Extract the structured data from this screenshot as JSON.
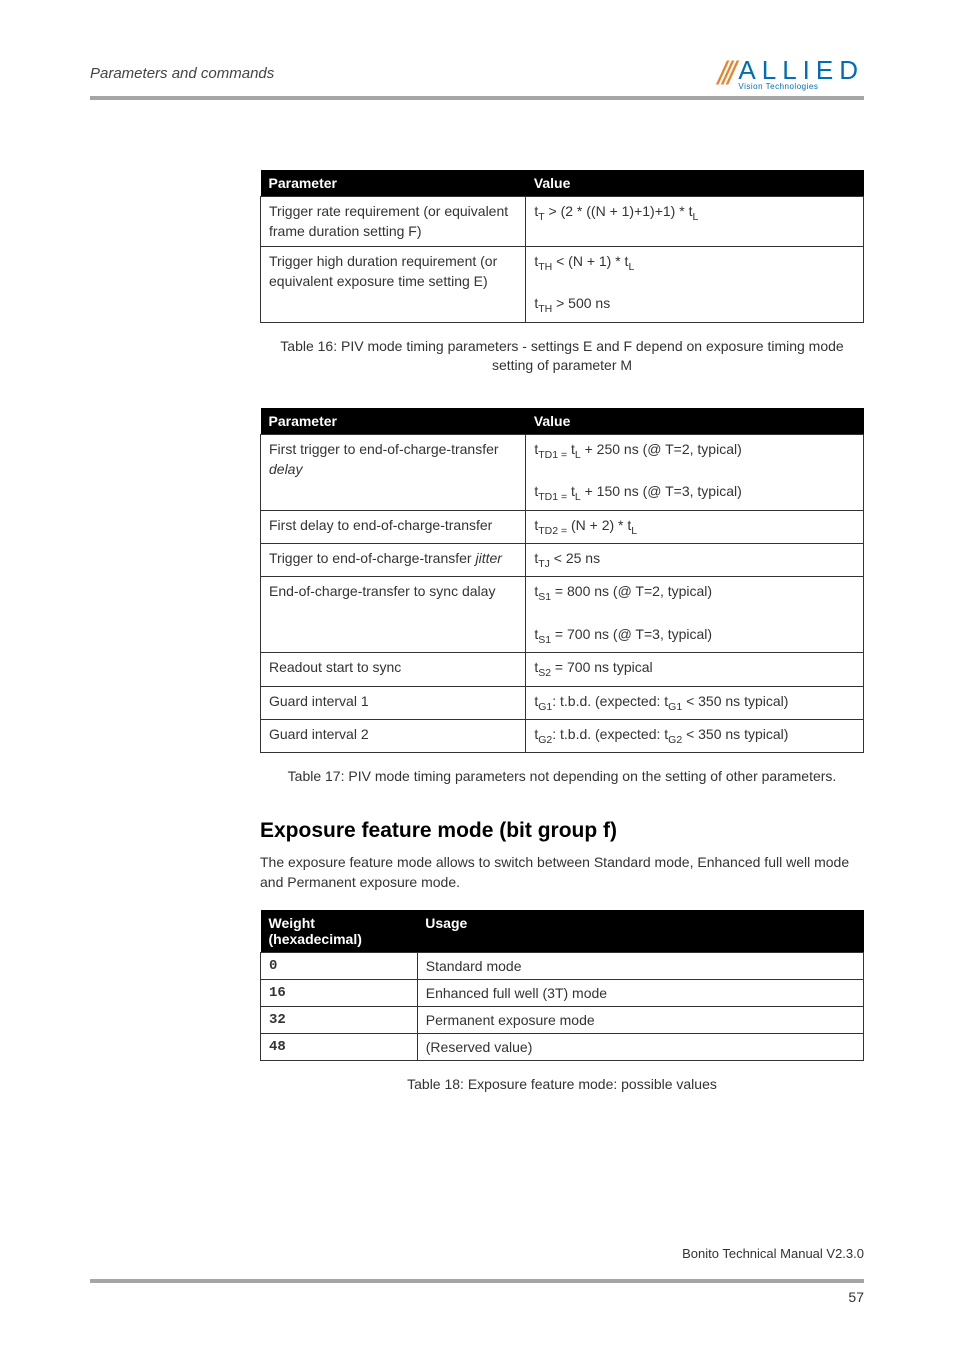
{
  "header": {
    "section": "Parameters and commands",
    "logo_main": "ALLIED",
    "logo_sub": "Vision Technologies"
  },
  "table16": {
    "col1": "Parameter",
    "col2": "Value",
    "rows": [
      {
        "p": "Trigger rate requirement (or equivalent frame duration setting F)",
        "v": "t<sub>T</sub> > (2 * ((N + 1)+1)+1) * t<sub>L</sub>"
      },
      {
        "p": "Trigger high duration requirement (or equivalent exposure time setting E)",
        "v": "t<sub>TH</sub> < (N + 1) * t<sub>L</sub><br><br>t<sub>TH</sub> > 500 ns"
      }
    ],
    "caption": "Table 16: PIV mode timing parameters - settings E and F depend on exposure timing mode setting of parameter M"
  },
  "table17": {
    "col1": "Parameter",
    "col2": "Value",
    "rows": [
      {
        "p": "First trigger to end-of-charge-transfer <span class=\"ital\">delay</span>",
        "v": "t<sub>TD1 =</sub> t<sub>L</sub> + 250 ns (@ T=2, typical)<br><br>t<sub>TD1 =</sub> t<sub>L</sub> + 150 ns (@ T=3, typical)"
      },
      {
        "p": "First delay to end-of-charge-transfer",
        "v": "t<sub>TD2 =</sub> (N + 2) * t<sub>L</sub>"
      },
      {
        "p": "Trigger to end-of-charge-transfer <span class=\"ital\">jitter</span>",
        "v": "t<sub>TJ</sub> < 25 ns"
      },
      {
        "p": "End-of-charge-transfer to sync dalay",
        "v": "t<sub>S1</sub> = 800 ns (@ T=2, typical)<br><br>t<sub>S1</sub> = 700 ns (@ T=3, typical)"
      },
      {
        "p": "Readout start to sync",
        "v": "t<sub>S2</sub> = 700 ns typical"
      },
      {
        "p": "Guard interval 1",
        "v": "t<sub>G1</sub>: t.b.d. (expected: t<sub>G1</sub> < 350 ns typical)"
      },
      {
        "p": "Guard interval 2",
        "v": "t<sub>G2</sub>: t.b.d. (expected: t<sub>G2</sub> < 350 ns typical)"
      }
    ],
    "caption": "Table 17: PIV mode timing parameters not depending on the setting of other parameters."
  },
  "section": {
    "heading": "Exposure feature mode (bit group f)",
    "text": "The exposure feature mode allows to switch between Standard mode, Enhanced full well mode and Permanent exposure mode."
  },
  "table18": {
    "col1": "Weight (hexadecimal)",
    "col2": "Usage",
    "rows": [
      {
        "w": "0",
        "u": "Standard mode"
      },
      {
        "w": "16",
        "u": "Enhanced full well (3T) mode"
      },
      {
        "w": "32",
        "u": "Permanent exposure mode"
      },
      {
        "w": "48",
        "u": "(Reserved value)"
      }
    ],
    "caption": "Table 18: Exposure feature mode: possible values"
  },
  "footer": {
    "manual": "Bonito Technical Manual V2.3.0",
    "page": "57"
  }
}
